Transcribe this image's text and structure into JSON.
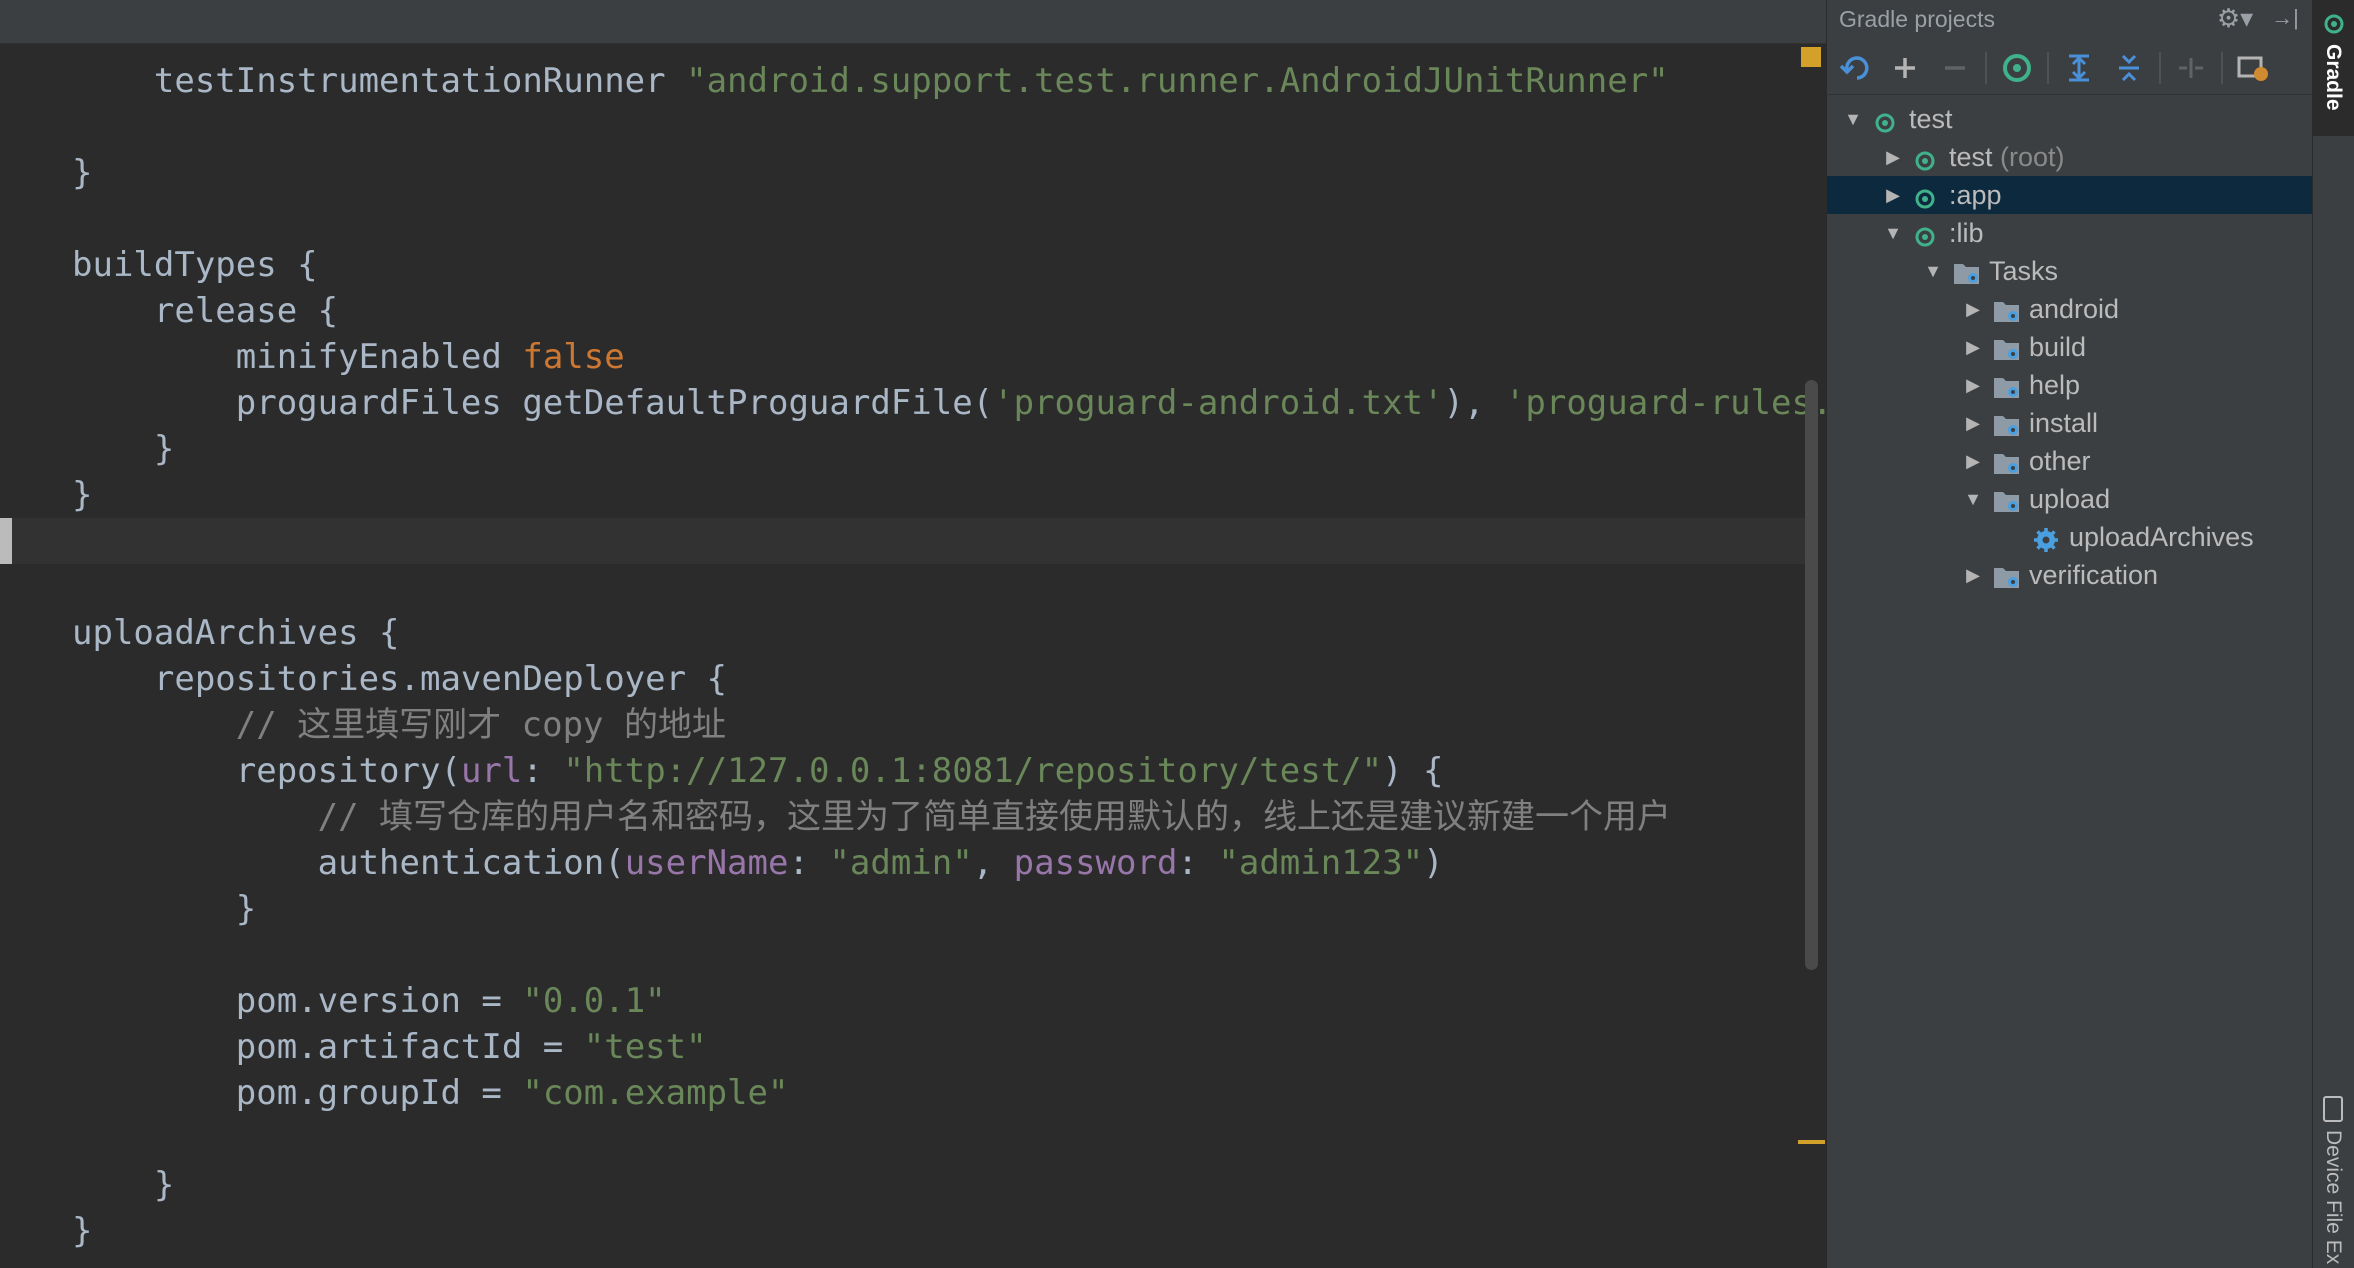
{
  "editor": {
    "lines": [
      [
        {
          "t": "    testInstrumentationRunner ",
          "c": "nm"
        },
        {
          "t": "\"android.support.test.runner.AndroidJUnitRunner\"",
          "c": "str"
        }
      ],
      [],
      [
        {
          "t": "}",
          "c": "nm"
        }
      ],
      [],
      [
        {
          "t": "buildTypes {",
          "c": "nm"
        }
      ],
      [
        {
          "t": "    release {",
          "c": "nm"
        }
      ],
      [
        {
          "t": "        minifyEnabled ",
          "c": "nm"
        },
        {
          "t": "false",
          "c": "kw"
        }
      ],
      [
        {
          "t": "        proguardFiles getDefaultProguardFile(",
          "c": "nm"
        },
        {
          "t": "'proguard-android.txt'",
          "c": "str"
        },
        {
          "t": "), ",
          "c": "nm"
        },
        {
          "t": "'proguard-rules.pr",
          "c": "str"
        }
      ],
      [
        {
          "t": "    }",
          "c": "nm"
        }
      ],
      [
        {
          "t": "}",
          "c": "nm"
        }
      ],
      [],
      [],
      [
        {
          "t": "uploadArchives {",
          "c": "nm"
        }
      ],
      [
        {
          "t": "    repositories.mavenDeployer {",
          "c": "nm"
        }
      ],
      [
        {
          "t": "        // 这里填写刚才 copy 的地址",
          "c": "cmt"
        }
      ],
      [
        {
          "t": "        repository(",
          "c": "nm"
        },
        {
          "t": "url",
          "c": "par"
        },
        {
          "t": ": ",
          "c": "nm"
        },
        {
          "t": "\"http://127.0.0.1:8081/repository/test/\"",
          "c": "str"
        },
        {
          "t": ") {",
          "c": "nm"
        }
      ],
      [
        {
          "t": "            // 填写仓库的用户名和密码，这里为了简单直接使用默认的，线上还是建议新建一个用户",
          "c": "cmt"
        }
      ],
      [
        {
          "t": "            authentication(",
          "c": "nm"
        },
        {
          "t": "userName",
          "c": "par"
        },
        {
          "t": ": ",
          "c": "nm"
        },
        {
          "t": "\"admin\"",
          "c": "str"
        },
        {
          "t": ", ",
          "c": "nm"
        },
        {
          "t": "password",
          "c": "par"
        },
        {
          "t": ": ",
          "c": "nm"
        },
        {
          "t": "\"admin123\"",
          "c": "str"
        },
        {
          "t": ")",
          "c": "nm"
        }
      ],
      [
        {
          "t": "        }",
          "c": "nm"
        }
      ],
      [],
      [
        {
          "t": "        pom.version = ",
          "c": "nm"
        },
        {
          "t": "\"0.0.1\"",
          "c": "str"
        }
      ],
      [
        {
          "t": "        pom.artifactId = ",
          "c": "nm"
        },
        {
          "t": "\"test\"",
          "c": "str"
        }
      ],
      [
        {
          "t": "        pom.groupId = ",
          "c": "nm"
        },
        {
          "t": "\"com.example\"",
          "c": "str"
        }
      ],
      [],
      [
        {
          "t": "    }",
          "c": "nm"
        }
      ],
      [
        {
          "t": "}",
          "c": "nm"
        }
      ]
    ]
  },
  "gradle": {
    "title": "Gradle projects",
    "toolbar": [
      "refresh-icon",
      "add-icon",
      "remove-icon",
      "gradle-run-icon",
      "expand-all-icon",
      "collapse-all-icon",
      "link-icon",
      "settings-run-icon"
    ],
    "tree": [
      {
        "label": "test",
        "suffix": "",
        "depth": 0,
        "arrow": "down",
        "icon": "gradle",
        "selected": false
      },
      {
        "label": "test",
        "suffix": " (root)",
        "depth": 1,
        "arrow": "right",
        "icon": "gradle",
        "selected": false
      },
      {
        "label": ":app",
        "suffix": "",
        "depth": 1,
        "arrow": "right",
        "icon": "gradle",
        "selected": true
      },
      {
        "label": ":lib",
        "suffix": "",
        "depth": 1,
        "arrow": "down",
        "icon": "gradle",
        "selected": false
      },
      {
        "label": "Tasks",
        "suffix": "",
        "depth": 2,
        "arrow": "down",
        "icon": "folder",
        "selected": false
      },
      {
        "label": "android",
        "suffix": "",
        "depth": 3,
        "arrow": "right",
        "icon": "folder",
        "selected": false
      },
      {
        "label": "build",
        "suffix": "",
        "depth": 3,
        "arrow": "right",
        "icon": "folder",
        "selected": false
      },
      {
        "label": "help",
        "suffix": "",
        "depth": 3,
        "arrow": "right",
        "icon": "folder",
        "selected": false
      },
      {
        "label": "install",
        "suffix": "",
        "depth": 3,
        "arrow": "right",
        "icon": "folder",
        "selected": false
      },
      {
        "label": "other",
        "suffix": "",
        "depth": 3,
        "arrow": "right",
        "icon": "folder",
        "selected": false
      },
      {
        "label": "upload",
        "suffix": "",
        "depth": 3,
        "arrow": "down",
        "icon": "folder",
        "selected": false
      },
      {
        "label": "uploadArchives",
        "suffix": "",
        "depth": 4,
        "arrow": "none",
        "icon": "gear",
        "selected": false
      },
      {
        "label": "verification",
        "suffix": "",
        "depth": 3,
        "arrow": "right",
        "icon": "folder",
        "selected": false
      }
    ]
  },
  "strip": {
    "gradle_tab": "Gradle",
    "device_tab": "Device File Ex"
  },
  "colors": {
    "background": "#2b2b2b",
    "panel": "#3c3f41",
    "selection": "#0d293e",
    "string": "#6a8759",
    "keyword": "#cc7832",
    "param": "#9876aa",
    "gradle_green": "#3fb28b"
  }
}
